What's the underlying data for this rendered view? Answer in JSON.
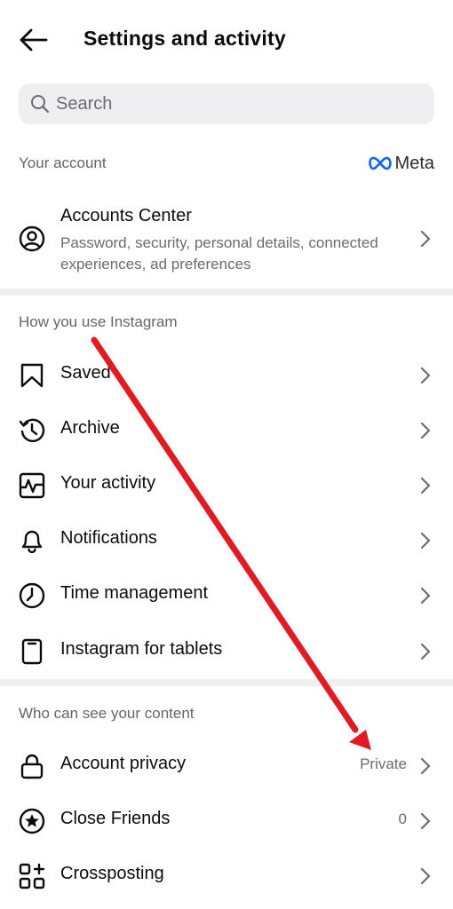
{
  "header": {
    "title": "Settings and activity"
  },
  "search": {
    "placeholder": "Search"
  },
  "your_account": {
    "label": "Your account",
    "brand": "Meta",
    "accounts_center": {
      "title": "Accounts Center",
      "subtitle": "Password, security, personal details, connected experiences, ad preferences"
    }
  },
  "how_you_use": {
    "label": "How you use Instagram",
    "items": [
      {
        "label": "Saved",
        "icon": "bookmark-icon"
      },
      {
        "label": "Archive",
        "icon": "archive-icon"
      },
      {
        "label": "Your activity",
        "icon": "activity-icon"
      },
      {
        "label": "Notifications",
        "icon": "bell-icon"
      },
      {
        "label": "Time management",
        "icon": "clock-icon"
      },
      {
        "label": "Instagram for tablets",
        "icon": "tablet-icon"
      }
    ]
  },
  "who_can_see": {
    "label": "Who can see your content",
    "items": [
      {
        "label": "Account privacy",
        "value": "Private",
        "icon": "lock-icon"
      },
      {
        "label": "Close Friends",
        "value": "0",
        "icon": "star-icon"
      },
      {
        "label": "Crossposting",
        "icon": "crossposting-icon"
      }
    ]
  },
  "annotation": {
    "color": "#e11b22"
  }
}
